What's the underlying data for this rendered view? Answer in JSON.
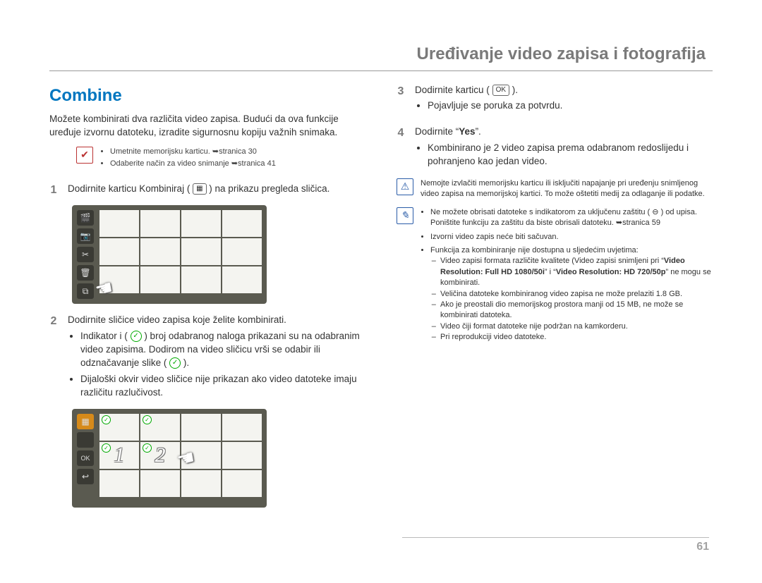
{
  "header": {
    "title": "Uređivanje video zapisa i fotografija"
  },
  "section": {
    "title": "Combine"
  },
  "intro": "Možete kombinirati dva različita video zapisa. Budući da ova funkcije uređuje izvornu datoteku, izradite sigurnosnu kopiju važnih snimaka.",
  "precond": {
    "items": [
      "Umetnite memorijsku karticu. ➥stranica 30",
      "Odaberite način za video snimanje ➥stranica 41"
    ]
  },
  "steps": {
    "s1": {
      "num": "1",
      "text_before": "Dodirnite karticu Kombiniraj (",
      "icon_label": "▦",
      "text_after": ") na prikazu pregleda sličica."
    },
    "s2": {
      "num": "2",
      "text": "Dodirnite sličice video zapisa koje želite kombinirati.",
      "bullets": [
        {
          "pre": "Indikator i (",
          "mid": ") broj odabranog naloga prikazani su na odabranim video zapisima. Dodirom na video sličicu vrši se odabir ili odznačavanje slike (",
          "post": ")."
        },
        {
          "text": "Dijaloški okvir video sličice nije prikazan ako video datoteke imaju različitu razlučivost."
        }
      ]
    },
    "s3": {
      "num": "3",
      "text_before": "Dodirnite karticu (",
      "icon_label": "OK",
      "text_after": ").",
      "sub": "Pojavljuje se poruka za potvrdu."
    },
    "s4": {
      "num": "4",
      "text_before": "Dodirnite “",
      "yes": "Yes",
      "text_after": "”.",
      "sub": "Kombinirano je 2 video zapisa prema odabranom redoslijedu i pohranjeno kao jedan video."
    }
  },
  "warn": {
    "text": "Nemojte izvlačiti memorijsku karticu ili isključiti napajanje pri uređenju snimljenog video zapisa na memorijskoj kartici. To može oštetiti medij za odlaganje ili podatke."
  },
  "info": {
    "items": [
      {
        "text_before": "Ne možete obrisati datoteke s indikatorom za uključenu zaštitu (",
        "icon": "⊖",
        "text_after": ") od upisa. Poništite funkciju za zaštitu da biste obrisali datoteku. ➥stranica 59"
      },
      {
        "text": "Izvorni video zapis neće biti sačuvan."
      },
      {
        "text": "Funkcija za kombiniranje nije dostupna u sljedećim uvjetima:",
        "sub": [
          {
            "pre": "Video zapisi formata različite kvalitete (Video zapisi snimljeni pri “",
            "b1": "Video Resolution: Full HD 1080/50i",
            "mid": "” i “",
            "b2": "Video Resolution: HD 720/50p",
            "post": "” ne mogu se kombinirati."
          },
          {
            "text": "Veličina datoteke kombiniranog video zapisa ne može prelaziti 1.8 GB."
          },
          {
            "text": "Ako je preostali dio memorijskog prostora manji od 15 MB, ne može se kombinirati datoteka."
          },
          {
            "text": "Video čiji format datoteke nije podržan na kamkorderu."
          },
          {
            "text": "Pri reprodukciji video datoteke."
          }
        ]
      }
    ]
  },
  "sidebar": {
    "a": [
      "🎬",
      "📷",
      "✂",
      "🗑",
      "⧉"
    ],
    "b": [
      "▦",
      "",
      "OK",
      "↩",
      ""
    ]
  },
  "page": {
    "num": "61"
  }
}
